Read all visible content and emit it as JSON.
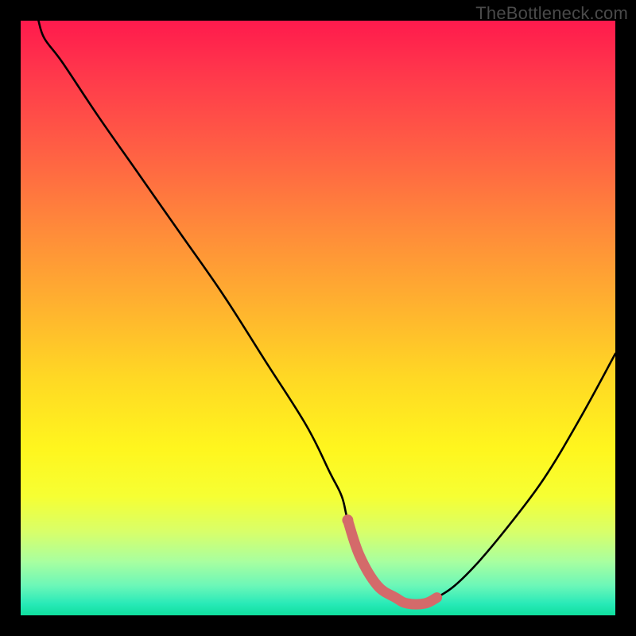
{
  "watermark": "TheBottleneck.com",
  "colors": {
    "frame": "#000000",
    "curve": "#000000",
    "highlight_stroke": "#d46a6a",
    "highlight_dot": "#d46a6a",
    "gradient_top": "#ff1a4d",
    "gradient_bottom": "#0fdf9e"
  },
  "chart_data": {
    "type": "line",
    "title": "",
    "xlabel": "",
    "ylabel": "",
    "xlim": [
      0,
      100
    ],
    "ylim": [
      0,
      100
    ],
    "grid": false,
    "series": [
      {
        "name": "bottleneck-curve",
        "x": [
          3,
          4,
          7,
          13,
          20,
          27,
          34,
          41,
          48,
          52,
          54,
          55,
          57,
          60,
          63,
          65,
          68,
          70,
          73,
          77,
          82,
          88,
          94,
          100
        ],
        "values": [
          100,
          97,
          93,
          84,
          74,
          64,
          54,
          43,
          32,
          24,
          20,
          16,
          10,
          5,
          3,
          2,
          2,
          3,
          5,
          9,
          15,
          23,
          33,
          44
        ]
      }
    ],
    "highlight": {
      "name": "optimal-range",
      "x": [
        55,
        57,
        60,
        63,
        65,
        68,
        70
      ],
      "values": [
        16,
        10,
        5,
        3,
        2,
        2,
        3
      ]
    },
    "highlight_dot": {
      "x": 55,
      "value": 16
    }
  }
}
